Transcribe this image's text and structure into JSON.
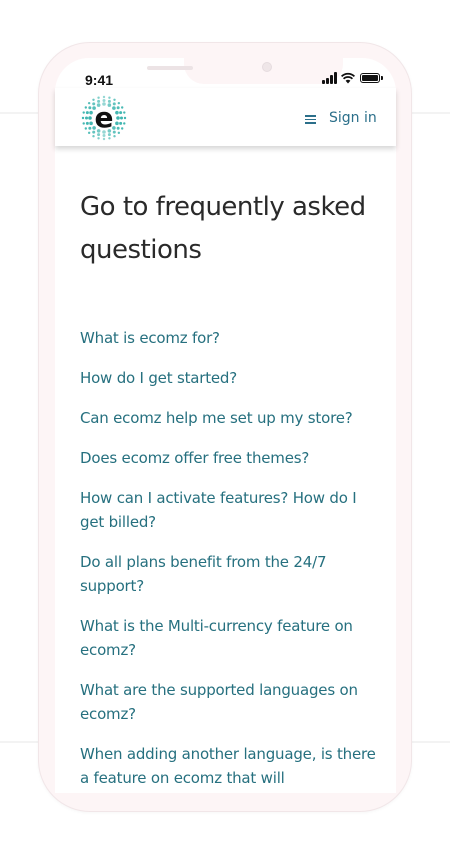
{
  "status_bar": {
    "time": "9:41"
  },
  "header": {
    "logo_alt": "e",
    "menu_icon": "hamburger-icon",
    "signin_label": "Sign in"
  },
  "main": {
    "title": "Go to frequently asked questions",
    "faq_links": [
      "What is ecomz for?",
      "How do I get started?",
      "Can ecomz help me set up my store?",
      "Does ecomz offer free themes?",
      "How can I activate features? How do I get billed?",
      "Do all plans benefit from the 24/7 support?",
      "What is the Multi-currency feature on ecomz?",
      "What are the supported languages on ecomz?",
      "When adding another language, is there a feature on ecomz that will"
    ]
  },
  "colors": {
    "link": "#26707f",
    "accent": "#2b6f8a",
    "logo_dots": "#3fb6b0"
  }
}
